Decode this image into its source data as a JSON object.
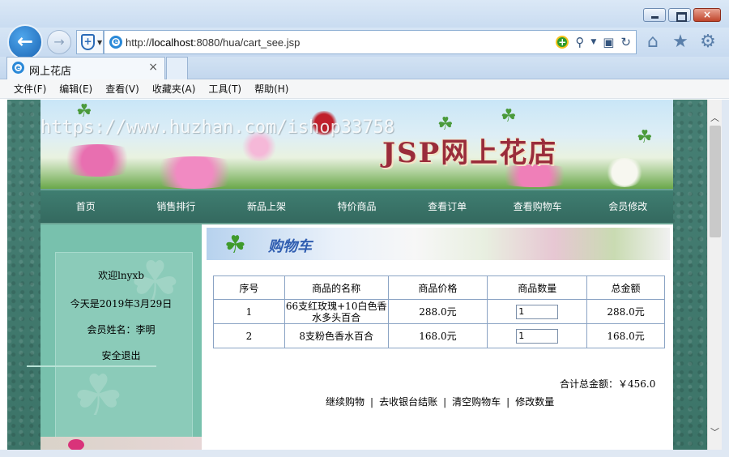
{
  "browser": {
    "url_prefix": "http://",
    "url_host": "localhost",
    "url_rest": ":8080/hua/cart_see.jsp",
    "tab_title": "网上花店",
    "close_glyph": "×",
    "menu": [
      "文件(F)",
      "编辑(E)",
      "查看(V)",
      "收藏夹(A)",
      "工具(T)",
      "帮助(H)"
    ]
  },
  "site": {
    "banner_title": "JSP网上花店",
    "watermark": "https://www.huzhan.com/ishop33758",
    "nav": [
      "首页",
      "销售排行",
      "新品上架",
      "特价商品",
      "查看订单",
      "查看购物车",
      "会员修改"
    ]
  },
  "sidebar": {
    "welcome": "欢迎lnyxb",
    "today": "今天是2019年3月29日",
    "member": "会员姓名：李明",
    "logout": "安全退出"
  },
  "cart": {
    "banner_title": "购物车",
    "headers": [
      "序号",
      "商品的名称",
      "商品价格",
      "商品数量",
      "总金额"
    ],
    "rows": [
      {
        "no": "1",
        "name": "66支红玫瑰+10白色香水多头百合",
        "price": "288.0元",
        "qty": "1",
        "total": "288.0元"
      },
      {
        "no": "2",
        "name": "8支粉色香水百合",
        "price": "168.0元",
        "qty": "1",
        "total": "168.0元"
      }
    ],
    "grand_total": "合计总金额：￥456.0",
    "actions": [
      "继续购物",
      "去收银台结账",
      "清空购物车",
      "修改数量"
    ],
    "separator": "|"
  },
  "colors": {
    "page_bg": "#3d7a6f",
    "sidebar_bg": "#78c1ad",
    "nav_bg": "#3f7e71",
    "title_red": "#9a2c3b"
  }
}
